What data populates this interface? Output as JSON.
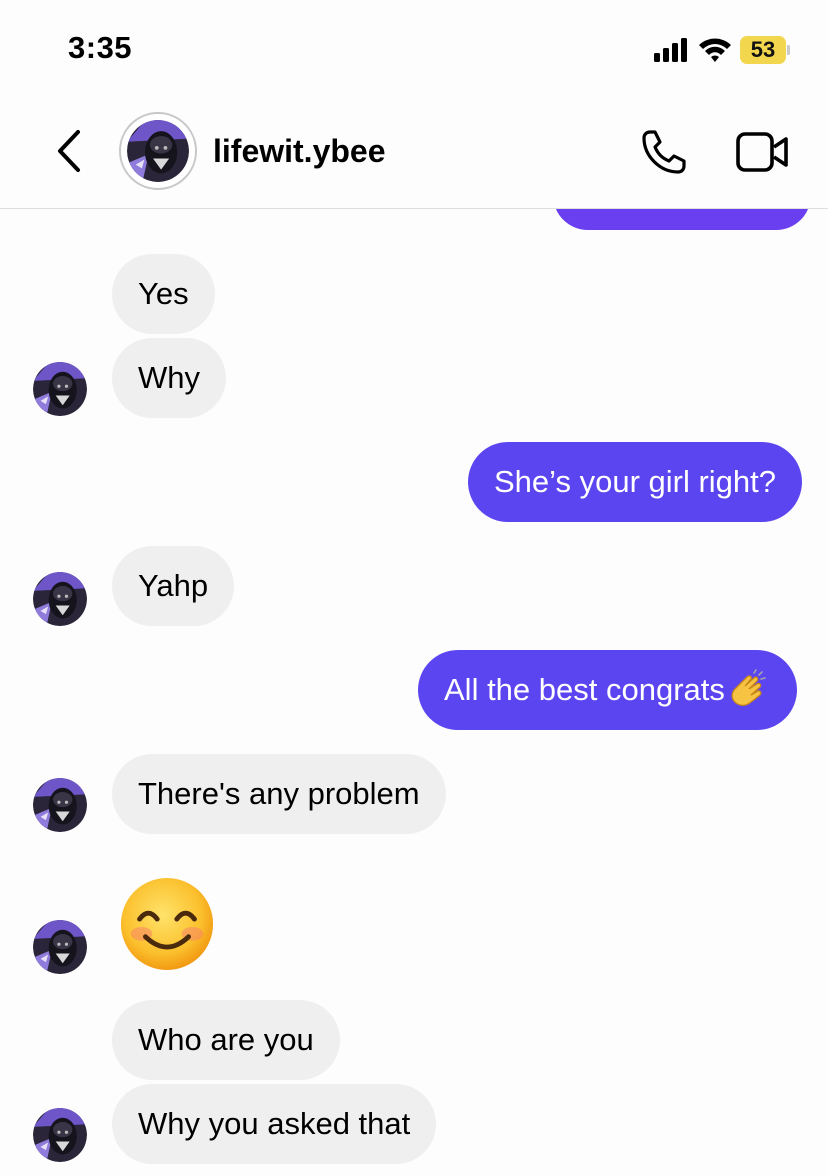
{
  "status_bar": {
    "time": "3:35",
    "battery_level": "53",
    "battery_color": "#f2d64e"
  },
  "header": {
    "username": "lifewit.ybee",
    "icons": [
      "chevron-left-icon",
      "phone-icon",
      "video-camera-icon"
    ]
  },
  "colors": {
    "outgoing_bubble": "#5b45f0",
    "incoming_bubble": "#efefef"
  },
  "messages": [
    {
      "direction": "incoming",
      "text": "Yes"
    },
    {
      "direction": "incoming",
      "text": "Why"
    },
    {
      "direction": "outgoing",
      "text": "She’s your girl right?"
    },
    {
      "direction": "incoming",
      "text": "Yahp"
    },
    {
      "direction": "outgoing",
      "text": "All the best congrats",
      "emoji": "clapping-hands"
    },
    {
      "direction": "incoming",
      "text": "There's any problem"
    },
    {
      "direction": "incoming",
      "emoji": "smiling-face-with-smiling-eyes"
    },
    {
      "direction": "incoming",
      "text": "Who are you"
    },
    {
      "direction": "incoming",
      "text": "Why you asked that"
    }
  ]
}
